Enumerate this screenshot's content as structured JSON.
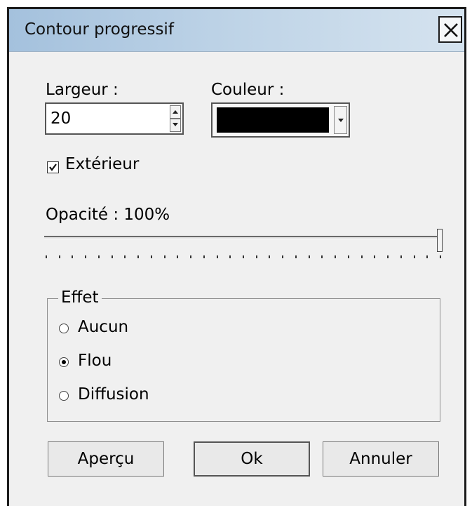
{
  "dialog": {
    "title": "Contour progressif",
    "close_icon": "close-icon"
  },
  "width": {
    "label": "Largeur :",
    "value": "20"
  },
  "color": {
    "label": "Couleur :",
    "selected": "#000000"
  },
  "outside": {
    "label": "Extérieur",
    "checked": true
  },
  "opacity": {
    "label": "Opacité : 100%",
    "value": 1.0
  },
  "effect": {
    "title": "Effet",
    "options": [
      {
        "label": "Aucun",
        "selected": false
      },
      {
        "label": "Flou",
        "selected": true
      },
      {
        "label": "Diffusion",
        "selected": false
      }
    ]
  },
  "buttons": {
    "preview": "Aperçu",
    "ok": "Ok",
    "cancel": "Annuler"
  }
}
